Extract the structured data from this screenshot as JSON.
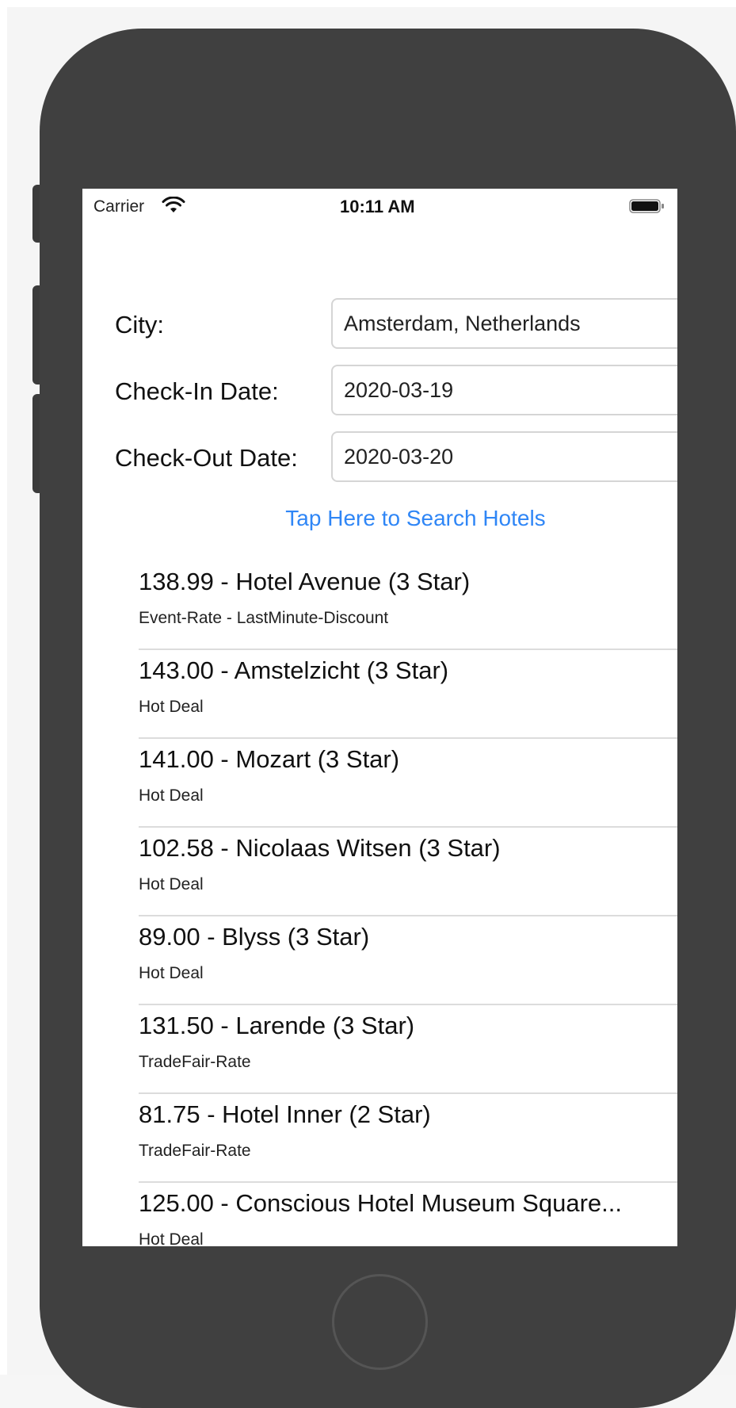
{
  "status_bar": {
    "carrier": "Carrier",
    "time": "10:11 AM",
    "wifi_icon": "wifi-icon",
    "battery_icon": "battery-icon"
  },
  "form": {
    "city_label": "City:",
    "city_value": "Amsterdam, Netherlands",
    "checkin_label": "Check-In Date:",
    "checkin_value": "2020-03-19",
    "checkout_label": "Check-Out Date:",
    "checkout_value": "2020-03-20",
    "search_button": "Tap Here to Search Hotels"
  },
  "hotels": [
    {
      "title": "138.99 - Hotel Avenue (3 Star)",
      "subtitle": "Event-Rate - LastMinute-Discount"
    },
    {
      "title": "143.00 - Amstelzicht (3 Star)",
      "subtitle": "Hot Deal"
    },
    {
      "title": "141.00 - Mozart (3 Star)",
      "subtitle": "Hot Deal"
    },
    {
      "title": "102.58 - Nicolaas Witsen (3 Star)",
      "subtitle": "Hot Deal"
    },
    {
      "title": "89.00 - Blyss (3 Star)",
      "subtitle": "Hot Deal"
    },
    {
      "title": "131.50 - Larende (3 Star)",
      "subtitle": "TradeFair-Rate"
    },
    {
      "title": "81.75 - Hotel Inner (2 Star)",
      "subtitle": "TradeFair-Rate"
    },
    {
      "title": "125.00 - Conscious Hotel Museum Square...",
      "subtitle": "Hot Deal"
    }
  ],
  "colors": {
    "device_body": "#404040",
    "link_blue": "#2f86f6",
    "separator": "#dcdcdc"
  }
}
